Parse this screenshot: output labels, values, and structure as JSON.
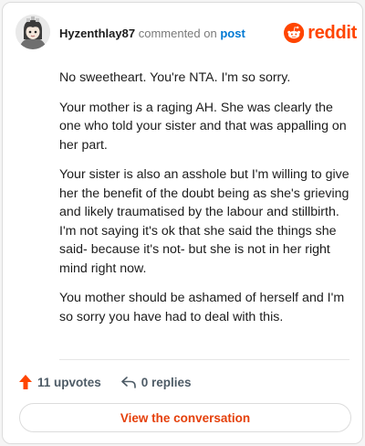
{
  "comment": {
    "username": "Hyzenthlay87",
    "action_text": "commented on",
    "target_link": "post",
    "paragraphs": [
      "No sweetheart. You're NTA. I'm so sorry.",
      "Your mother is a raging AH. She was clearly the one who told your sister and that was appalling on her part.",
      "Your sister is also an asshole but I'm willing to give her the benefit of the doubt being as she's grieving and likely traumatised by the labour and stillbirth. I'm not saying it's ok that she said the things she said- because it's not- but she is not in her right mind right now.",
      "You mother should be ashamed of herself and I'm so sorry you have had to deal with this."
    ]
  },
  "brand": {
    "name": "reddit",
    "icon": "reddit-snoo-icon",
    "color": "#ff4500"
  },
  "footer": {
    "upvotes_label": "11 upvotes",
    "upvote_icon": "upvote-arrow-icon",
    "upvote_color": "#ff4500",
    "replies_label": "0 replies",
    "reply_icon": "reply-arrow-icon",
    "view_button_label": "View the conversation"
  }
}
